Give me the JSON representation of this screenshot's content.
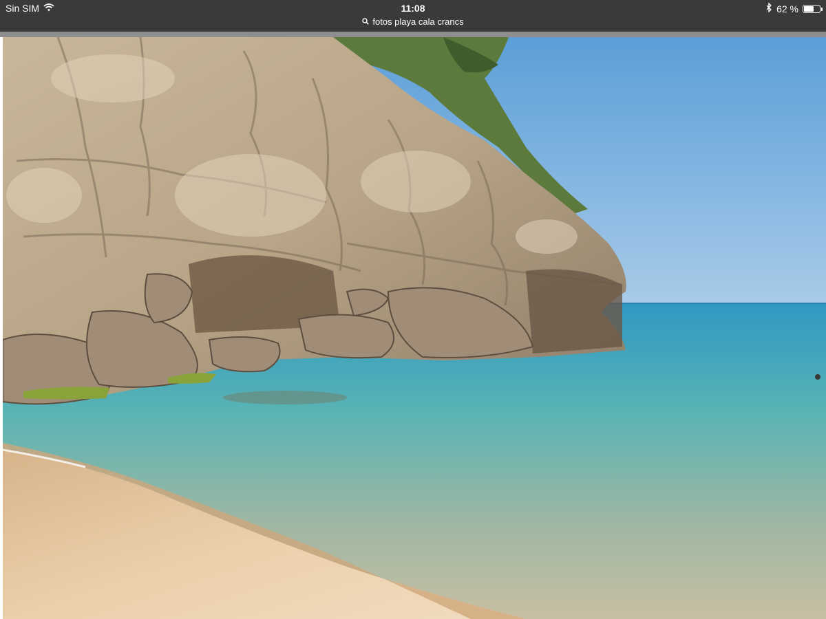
{
  "status_bar": {
    "carrier": "Sin SIM",
    "time": "11:08",
    "url_text": "fotos playa cala crancs",
    "battery_text": "62 %",
    "battery_level": 0.62,
    "icons": [
      "wifi-icon",
      "search-icon",
      "bluetooth-icon",
      "battery-icon"
    ]
  },
  "photo": {
    "alt": "fotos playa cala crancs"
  },
  "colors": {
    "status_bar_bg": "#3a3a3a",
    "sky": "#6aa5d8",
    "sea": "#3fa7b8",
    "sand": "#e9cba3"
  }
}
